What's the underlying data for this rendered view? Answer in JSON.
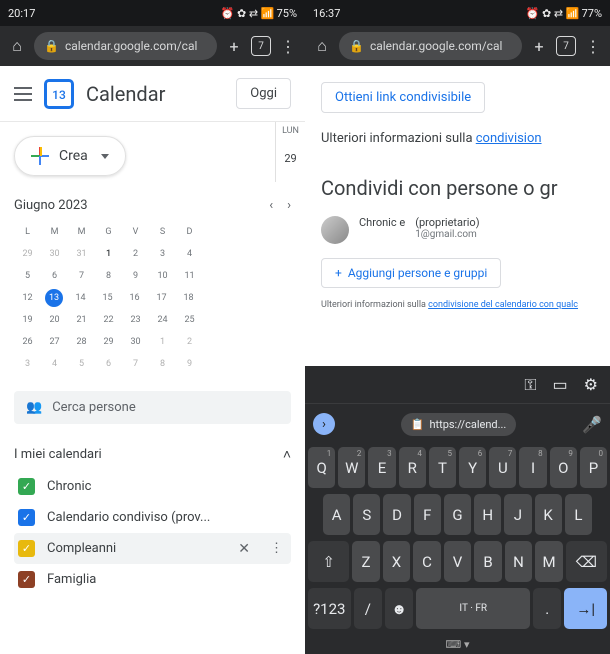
{
  "left": {
    "status": {
      "time": "20:17",
      "battery": "75%",
      "icons": "⏰ ✿ ⇄ 📶"
    },
    "chrome": {
      "url": "calendar.google.com/cal",
      "tabs": "7"
    },
    "app": {
      "logo_day": "13",
      "name": "Calendar",
      "today_btn": "Oggi"
    },
    "daycol": {
      "dow": "LUN",
      "num": "29"
    },
    "create_btn": "Crea",
    "month": "Giugno 2023",
    "dows": [
      "L",
      "M",
      "M",
      "G",
      "V",
      "S",
      "D"
    ],
    "grid": [
      [
        {
          "n": "29",
          "d": 1
        },
        {
          "n": "30",
          "d": 1
        },
        {
          "n": "31",
          "d": 1
        },
        {
          "n": "1",
          "b": 1
        },
        {
          "n": "2"
        },
        {
          "n": "3"
        },
        {
          "n": "4"
        }
      ],
      [
        {
          "n": "5"
        },
        {
          "n": "6"
        },
        {
          "n": "7"
        },
        {
          "n": "8"
        },
        {
          "n": "9"
        },
        {
          "n": "10"
        },
        {
          "n": "11"
        }
      ],
      [
        {
          "n": "12"
        },
        {
          "n": "13",
          "t": 1
        },
        {
          "n": "14"
        },
        {
          "n": "15"
        },
        {
          "n": "16"
        },
        {
          "n": "17"
        },
        {
          "n": "18"
        }
      ],
      [
        {
          "n": "19"
        },
        {
          "n": "20"
        },
        {
          "n": "21"
        },
        {
          "n": "22"
        },
        {
          "n": "23"
        },
        {
          "n": "24"
        },
        {
          "n": "25"
        }
      ],
      [
        {
          "n": "26"
        },
        {
          "n": "27"
        },
        {
          "n": "28"
        },
        {
          "n": "29"
        },
        {
          "n": "30"
        },
        {
          "n": "1",
          "d": 1
        },
        {
          "n": "2",
          "d": 1
        }
      ],
      [
        {
          "n": "3",
          "d": 1
        },
        {
          "n": "4",
          "d": 1
        },
        {
          "n": "5",
          "d": 1
        },
        {
          "n": "6",
          "d": 1
        },
        {
          "n": "7",
          "d": 1
        },
        {
          "n": "8",
          "d": 1
        },
        {
          "n": "9",
          "d": 1
        }
      ]
    ],
    "search_people": "Cerca persone",
    "my_cals": "I miei calendari",
    "cals": [
      {
        "name": "Chronic",
        "color": "#33a853",
        "sel": false
      },
      {
        "name": "Calendario condiviso (prov...",
        "color": "#1a73e8",
        "sel": false
      },
      {
        "name": "Compleanni",
        "color": "#e8b90e",
        "sel": true
      },
      {
        "name": "Famiglia",
        "color": "#8d4025",
        "sel": false
      }
    ]
  },
  "right": {
    "status": {
      "time": "16:37",
      "battery": "77%",
      "icons": "⏰ ✿ ⇄ 📶"
    },
    "chrome": {
      "url": "calendar.google.com/cal",
      "tabs": "7"
    },
    "share": {
      "get_link": "Ottieni link condivisibile",
      "info_prefix": "Ulteriori informazioni sulla ",
      "info_link": "condivision",
      "header": "Condividi con persone o gr",
      "owner_name": "Chronic e",
      "owner_role": "(proprietario)",
      "owner_email": "1@gmail.com",
      "add_btn": "Aggiungi persone e gruppi",
      "small_prefix": "Ulteriori informazioni sulla ",
      "small_link": "condivisione del calendario con qualc"
    },
    "kbd": {
      "suggestion": "https://calend...",
      "row1": [
        [
          "Q",
          "1"
        ],
        [
          "W",
          "2"
        ],
        [
          "E",
          "3"
        ],
        [
          "R",
          "4"
        ],
        [
          "T",
          "5"
        ],
        [
          "Y",
          "6"
        ],
        [
          "U",
          "7"
        ],
        [
          "I",
          "8"
        ],
        [
          "O",
          "9"
        ],
        [
          "P",
          "0"
        ]
      ],
      "row2": [
        "A",
        "S",
        "D",
        "F",
        "G",
        "H",
        "J",
        "K",
        "L"
      ],
      "row3": [
        "Z",
        "X",
        "C",
        "V",
        "B",
        "N",
        "M"
      ],
      "numkey": "?123",
      "space": "IT · FR"
    }
  }
}
